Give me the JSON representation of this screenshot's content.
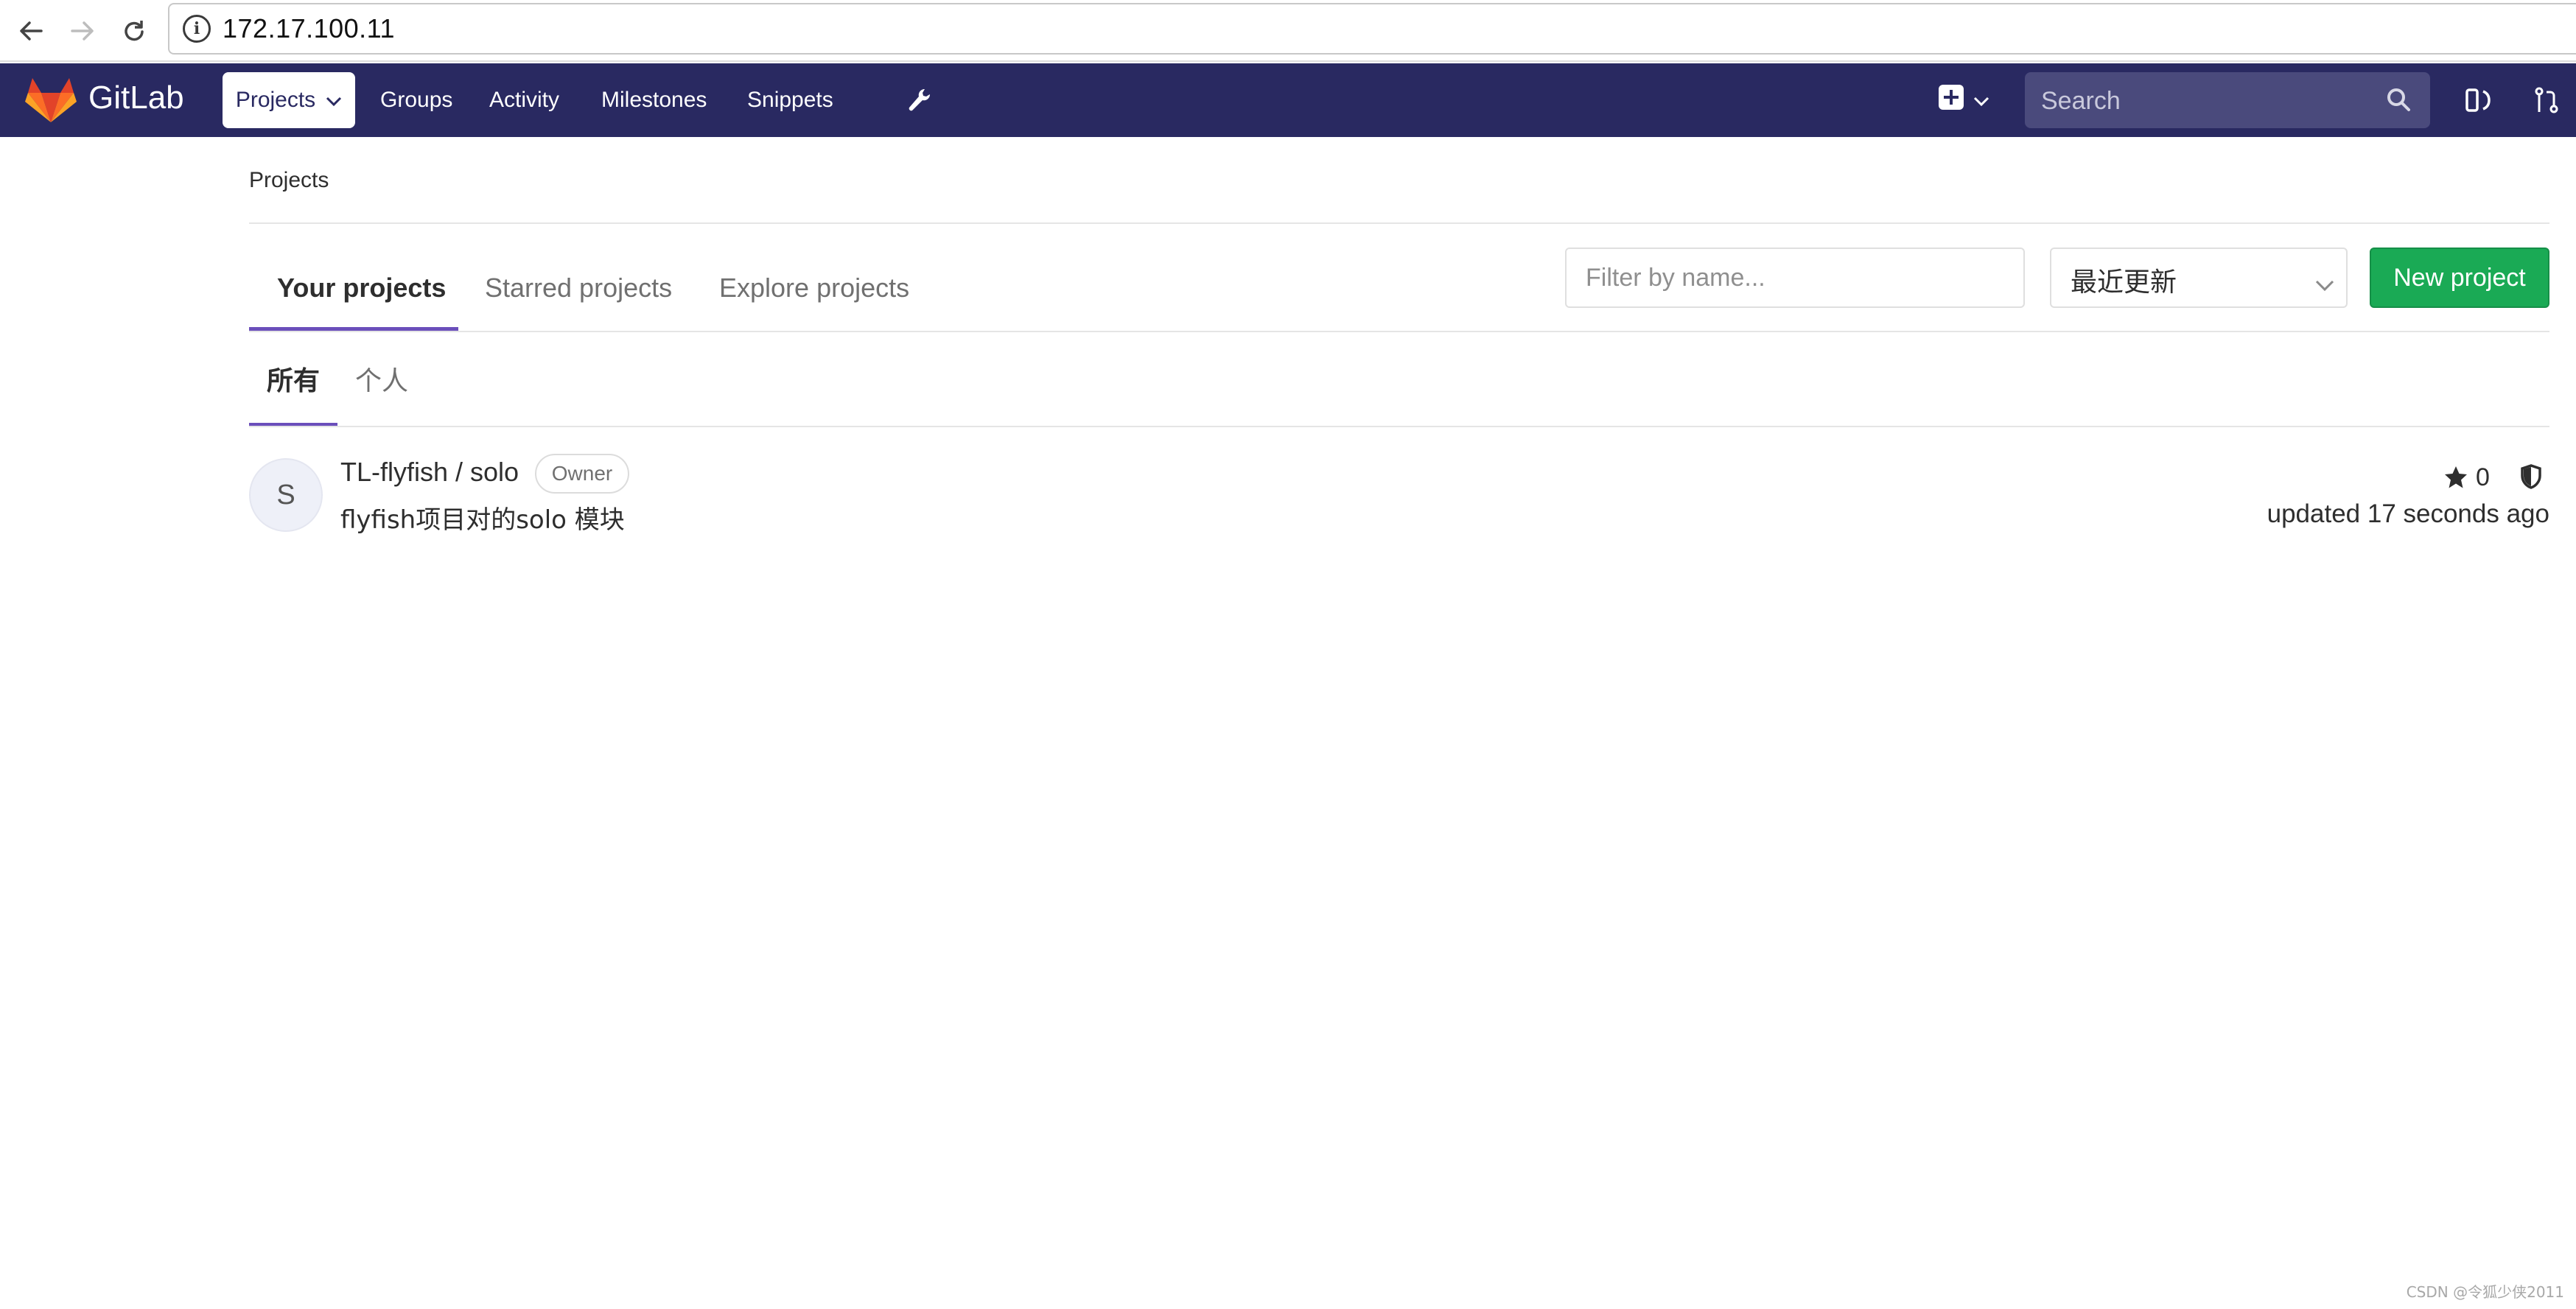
{
  "browser": {
    "url": "172.17.100.11",
    "back_icon": "arrow-left-icon",
    "forward_icon": "arrow-right-icon",
    "reload_icon": "reload-icon",
    "info_icon": "info-icon"
  },
  "navbar": {
    "brand": "GitLab",
    "items": [
      {
        "label": "Projects",
        "active": true
      },
      {
        "label": "Groups"
      },
      {
        "label": "Activity"
      },
      {
        "label": "Milestones"
      },
      {
        "label": "Snippets"
      }
    ],
    "admin_icon": "wrench-icon",
    "new_icon": "plus-square-icon",
    "search_placeholder": "Search",
    "issues_icon": "issues-icon",
    "merge_requests_icon": "merge-request-icon",
    "colors": {
      "background": "#292961",
      "search_bg": "#4a4a7c"
    }
  },
  "page": {
    "breadcrumb": "Projects",
    "tabs": [
      {
        "label": "Your projects",
        "active": true
      },
      {
        "label": "Starred projects"
      },
      {
        "label": "Explore projects"
      }
    ],
    "filter_placeholder": "Filter by name...",
    "sort_value": "最近更新",
    "new_project_label": "New project",
    "subtabs": [
      {
        "label": "所有",
        "active": true
      },
      {
        "label": "个人"
      }
    ],
    "accent_color": "#6b4fbb",
    "button_color": "#1aaa55"
  },
  "projects": [
    {
      "avatar_letter": "S",
      "name": "TL-flyfish / solo",
      "role": "Owner",
      "description": "flyfish项目对的solo 模块",
      "stars": "0",
      "updated": "updated 17 seconds ago",
      "visibility_icon": "shield-icon"
    }
  ],
  "watermark": "CSDN @令狐少侠2011"
}
